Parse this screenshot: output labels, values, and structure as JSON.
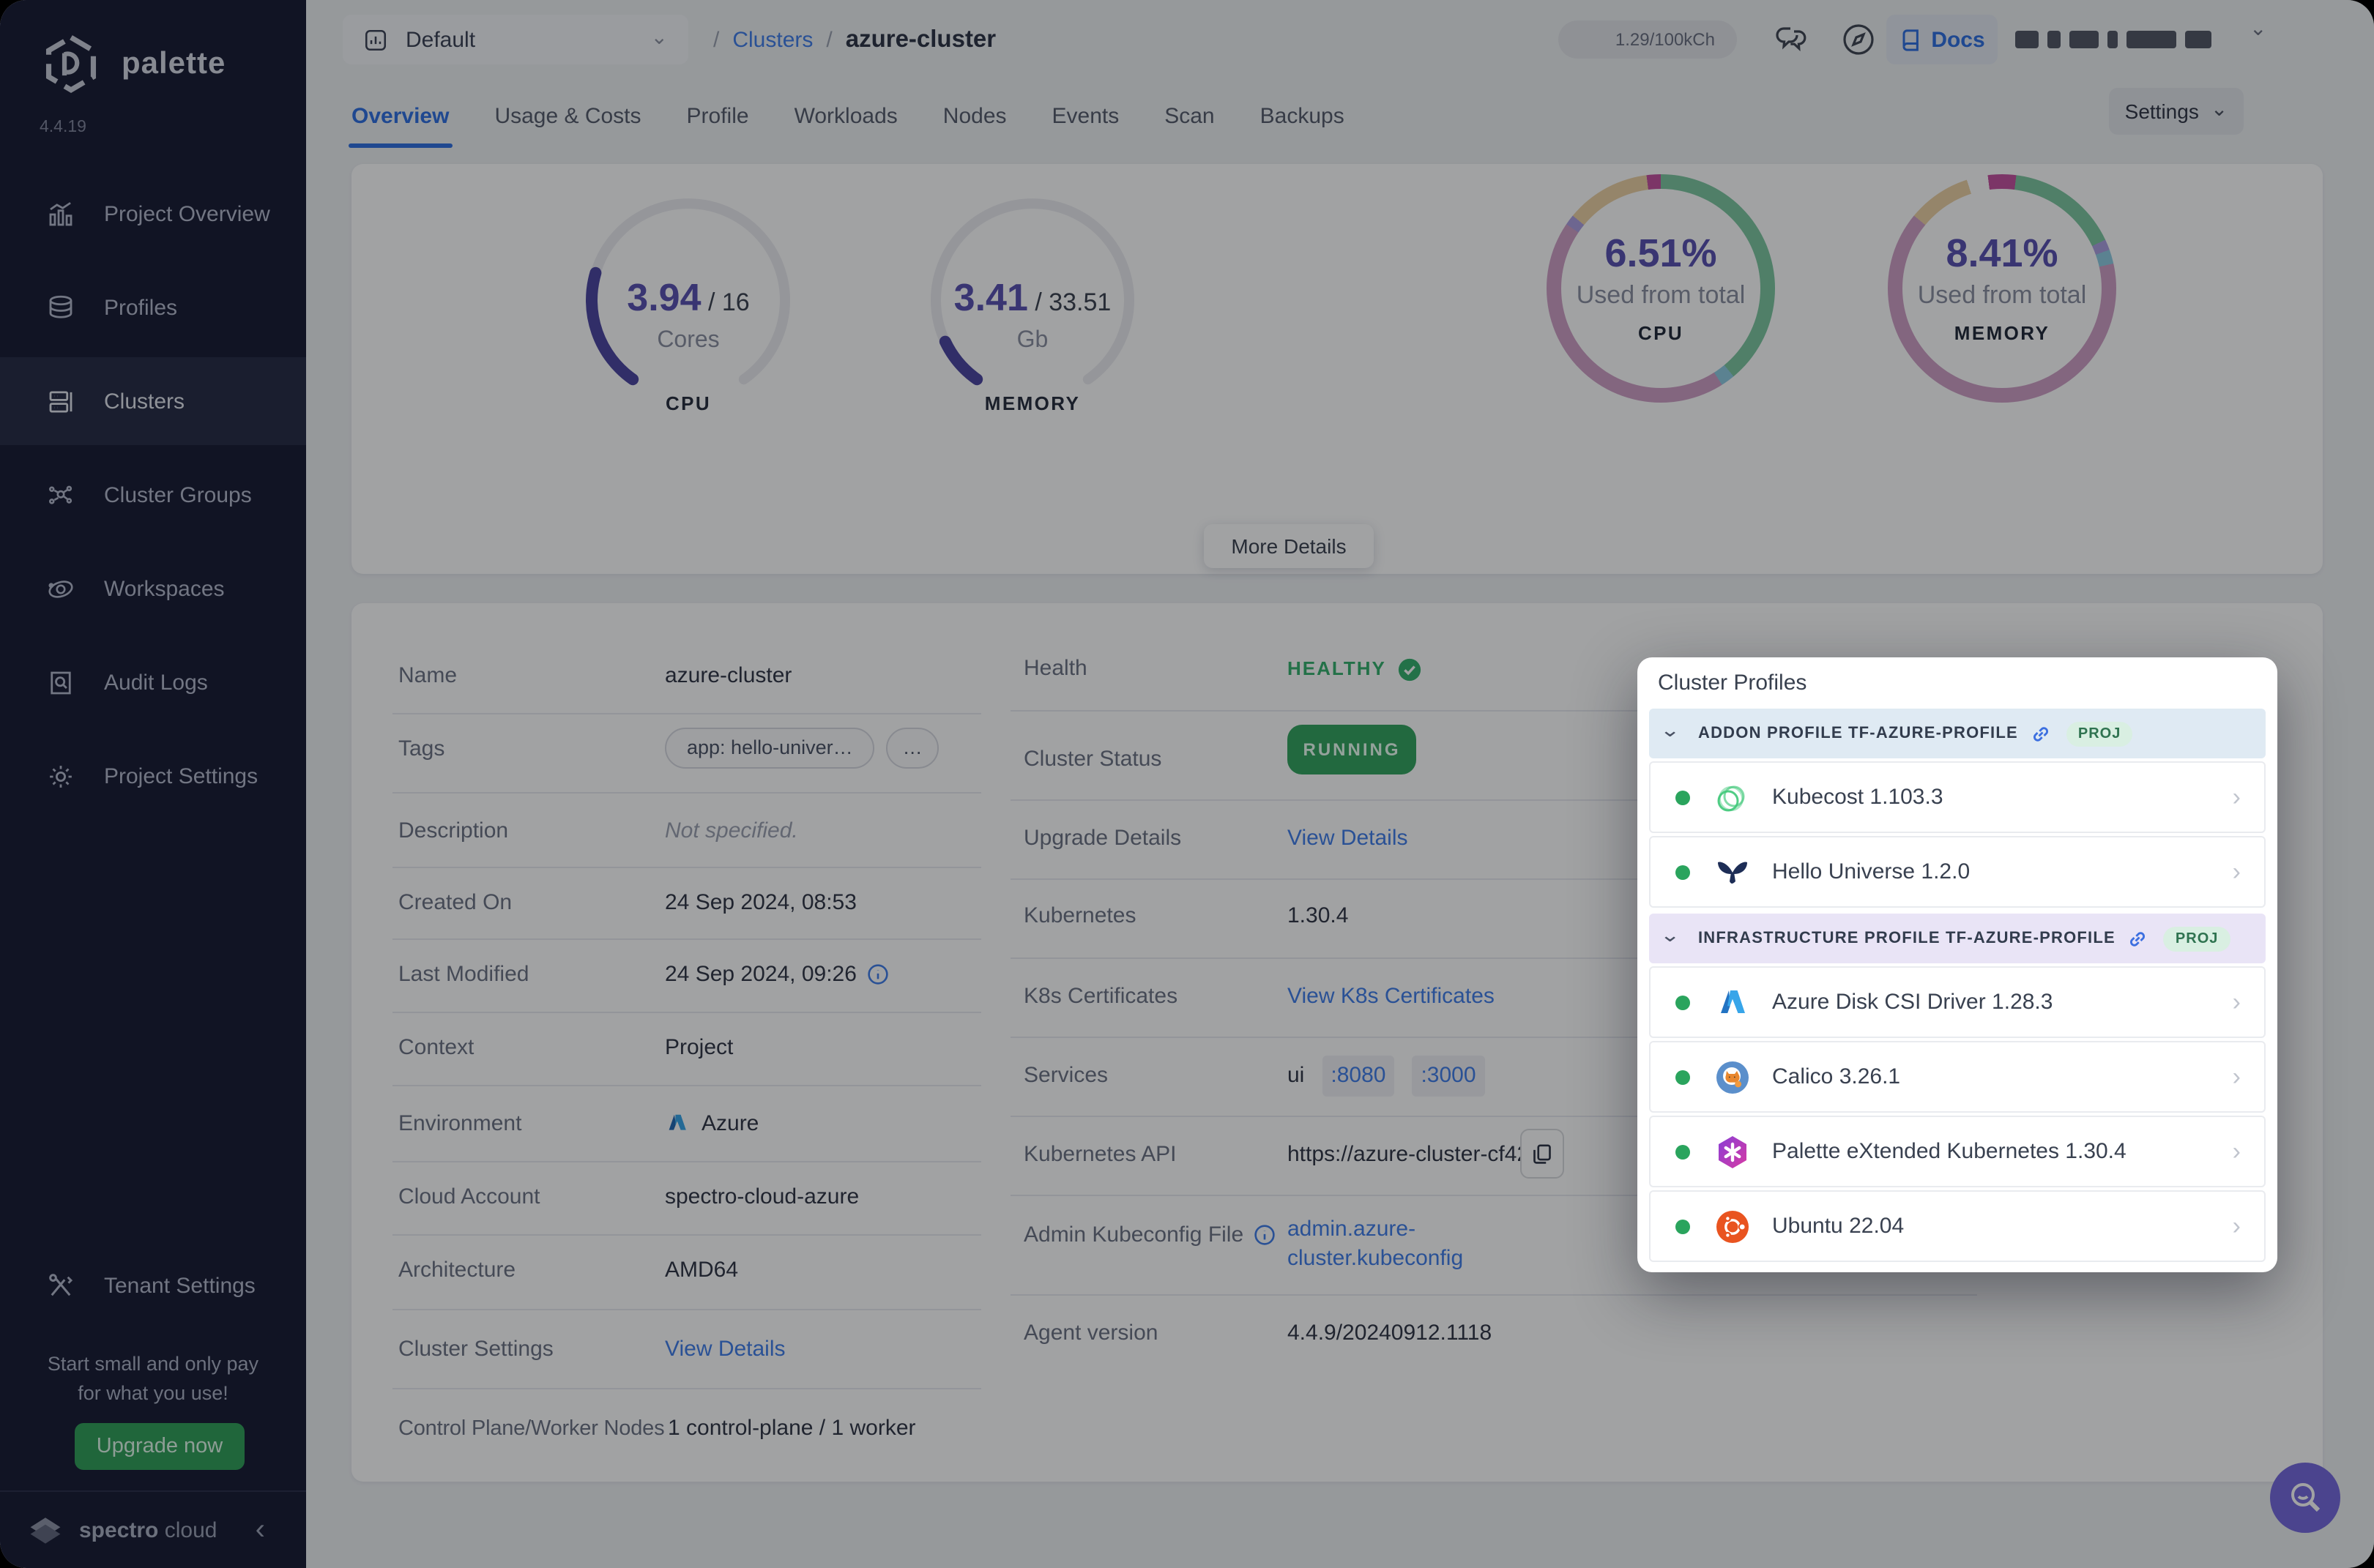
{
  "app": {
    "brand": "palette",
    "version": "4.4.19"
  },
  "colors": {
    "accent_blue": "#2e6fe0",
    "link_blue": "#3f7ce8",
    "green": "#2e9e60",
    "running_green": "#33a35e",
    "indigo": "#574fb0",
    "sidebar_bg": "#171a33",
    "upgrade_green": "#2f9e57",
    "fab_purple": "#7568dd"
  },
  "sidebar": {
    "items": [
      {
        "label": "Project Overview",
        "icon": "chart-icon",
        "selected": false
      },
      {
        "label": "Profiles",
        "icon": "layers-icon",
        "selected": false
      },
      {
        "label": "Clusters",
        "icon": "server-icon",
        "selected": true
      },
      {
        "label": "Cluster Groups",
        "icon": "network-icon",
        "selected": false
      },
      {
        "label": "Workspaces",
        "icon": "orbit-icon",
        "selected": false
      },
      {
        "label": "Audit Logs",
        "icon": "audit-icon",
        "selected": false
      },
      {
        "label": "Project Settings",
        "icon": "gear-icon",
        "selected": false
      }
    ],
    "tenant_label": "Tenant Settings",
    "promo_line1": "Start small and only pay",
    "promo_line2": "for what you use!",
    "upgrade_label": "Upgrade now",
    "footer_brand": "spectro",
    "footer_brand2": "cloud"
  },
  "topbar": {
    "project_selector": "Default",
    "breadcrumb_slash": "/",
    "breadcrumb_section": "Clusters",
    "breadcrumb_current": "azure-cluster",
    "usage_pill": "1.29/100kCh",
    "docs_label": "Docs"
  },
  "tabs": {
    "items": [
      "Overview",
      "Usage & Costs",
      "Profile",
      "Workloads",
      "Nodes",
      "Events",
      "Scan",
      "Backups"
    ],
    "active": "Overview",
    "settings_label": "Settings",
    "more_details": "More Details"
  },
  "chart_data": {
    "type": "gauge-and-donut",
    "gauges": [
      {
        "title": "CPU",
        "value": "3.94",
        "total": "16",
        "unit": "Cores",
        "fraction": 0.246
      },
      {
        "title": "MEMORY",
        "value": "3.41",
        "total": "33.51",
        "unit": "Gb",
        "fraction": 0.102
      }
    ],
    "donuts": [
      {
        "title": "CPU",
        "pct": "6.51%",
        "caption": "Used from total",
        "segments": [
          [
            "#7cc7a0",
            39
          ],
          [
            "#8ecbe3",
            2
          ],
          [
            "#cf9fc6",
            43.5
          ],
          [
            "#ab9fe0",
            1.5
          ],
          [
            "#ecd0a4",
            12
          ],
          [
            "#c4509e",
            2
          ]
        ]
      },
      {
        "title": "MEMORY",
        "pct": "8.41%",
        "caption": "Used from total",
        "segments": [
          [
            "#c4509e",
            2
          ],
          [
            "#7cc7a0",
            16
          ],
          [
            "#ab9fe0",
            1.5
          ],
          [
            "#8ecbe3",
            2
          ],
          [
            "#cf9fc6",
            64.5
          ],
          [
            "#ecd0a4",
            9
          ],
          [
            "#ffffff",
            3
          ],
          [
            "#c4509e",
            2
          ]
        ]
      }
    ]
  },
  "details": {
    "name": {
      "label": "Name",
      "value": "azure-cluster"
    },
    "tags": {
      "label": "Tags",
      "pill": "app: hello-univer…",
      "more": "…"
    },
    "description": {
      "label": "Description",
      "value": "Not specified."
    },
    "created": {
      "label": "Created On",
      "value": "24 Sep 2024, 08:53"
    },
    "modified": {
      "label": "Last Modified",
      "value": "24 Sep 2024, 09:26"
    },
    "context": {
      "label": "Context",
      "value": "Project"
    },
    "environment": {
      "label": "Environment",
      "value": "Azure"
    },
    "cloud_account": {
      "label": "Cloud Account",
      "value": "spectro-cloud-azure"
    },
    "architecture": {
      "label": "Architecture",
      "value": "AMD64"
    },
    "cluster_settings": {
      "label": "Cluster Settings",
      "value": "View Details"
    },
    "nodes": {
      "label": "Control Plane/Worker Nodes",
      "value": "1 control-plane / 1 worker"
    },
    "health": {
      "label": "Health",
      "value": "HEALTHY"
    },
    "status": {
      "label": "Cluster Status",
      "value": "RUNNING"
    },
    "upgrade": {
      "label": "Upgrade Details",
      "value": "View Details"
    },
    "kubernetes": {
      "label": "Kubernetes",
      "value": "1.30.4"
    },
    "certs": {
      "label": "K8s Certificates",
      "value": "View K8s Certificates"
    },
    "services": {
      "label": "Services",
      "prefix": "ui",
      "port1": ":8080",
      "port2": ":3000"
    },
    "api": {
      "label": "Kubernetes API",
      "value": "https://azure-cluster-cf42…"
    },
    "kubeconfig": {
      "label": "Admin Kubeconfig File",
      "line1": "admin.azure-",
      "line2": "cluster.kubeconfig"
    },
    "agent": {
      "label": "Agent version",
      "value": "4.4.9/20240912.1118"
    }
  },
  "profiles_panel": {
    "title": "Cluster Profiles",
    "sections": [
      {
        "header": "ADDON PROFILE TF-AZURE-PROFILE",
        "badge": "PROJ",
        "tint": "blue",
        "items": [
          {
            "name": "Kubecost 1.103.3",
            "icon": "kubecost"
          },
          {
            "name": "Hello Universe 1.2.0",
            "icon": "hello-universe"
          }
        ]
      },
      {
        "header": "INFRASTRUCTURE PROFILE TF-AZURE-PROFILE",
        "badge": "PROJ",
        "tint": "purple",
        "items": [
          {
            "name": "Azure Disk CSI Driver 1.28.3",
            "icon": "azure"
          },
          {
            "name": "Calico 3.26.1",
            "icon": "calico"
          },
          {
            "name": "Palette eXtended Kubernetes 1.30.4",
            "icon": "pxk"
          },
          {
            "name": "Ubuntu 22.04",
            "icon": "ubuntu"
          }
        ]
      }
    ]
  }
}
